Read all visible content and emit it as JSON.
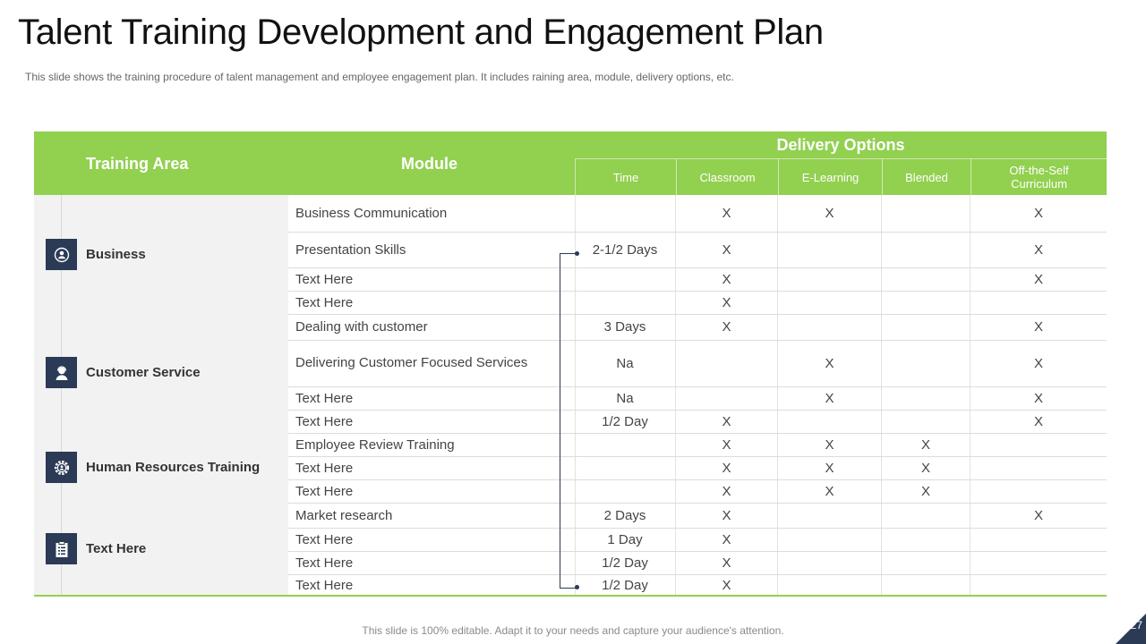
{
  "slide": {
    "title": "Talent Training Development and Engagement Plan",
    "subtitle": "This slide shows the training procedure  of talent management  and  employee  engagement  plan.  It includes raining area,  module,  delivery  options, etc.",
    "footer": "This slide is 100% editable. Adapt it to your needs and capture your audience's attention.",
    "page_number": "27"
  },
  "colors": {
    "accent_green": "#92d050",
    "icon_navy": "#2b3a55"
  },
  "table": {
    "headers": {
      "training_area": "Training Area",
      "module": "Module",
      "delivery_options": "Delivery Options",
      "time": "Time",
      "classroom": "Classroom",
      "elearning": "E-Learning",
      "blended": "Blended",
      "ots": "Off-the-Self Curriculum"
    },
    "areas": [
      {
        "label": "Business",
        "icon": "person-circle-icon"
      },
      {
        "label": "Customer Service",
        "icon": "headset-person-icon"
      },
      {
        "label": "Human Resources Training",
        "icon": "gear-person-icon"
      },
      {
        "label": "Text Here",
        "icon": "clipboard-icon"
      }
    ],
    "rows": [
      {
        "module": "Business Communication",
        "time": "",
        "classroom": "X",
        "elearning": "X",
        "blended": "",
        "ots": "X"
      },
      {
        "module": "Presentation Skills",
        "time": "2-1/2 Days",
        "classroom": "X",
        "elearning": "",
        "blended": "",
        "ots": "X"
      },
      {
        "module": "Text Here",
        "time": "",
        "classroom": "X",
        "elearning": "",
        "blended": "",
        "ots": "X"
      },
      {
        "module": "Text Here",
        "time": "",
        "classroom": "X",
        "elearning": "",
        "blended": "",
        "ots": ""
      },
      {
        "module": "Dealing with customer",
        "time": "3 Days",
        "classroom": "X",
        "elearning": "",
        "blended": "",
        "ots": "X"
      },
      {
        "module": "Delivering Customer Focused Services",
        "time": "Na",
        "classroom": "",
        "elearning": "X",
        "blended": "",
        "ots": "X"
      },
      {
        "module": "Text Here",
        "time": "Na",
        "classroom": "",
        "elearning": "X",
        "blended": "",
        "ots": "X"
      },
      {
        "module": "Text Here",
        "time": "1/2 Day",
        "classroom": "X",
        "elearning": "",
        "blended": "",
        "ots": "X"
      },
      {
        "module": "Employee Review Training",
        "time": "",
        "classroom": "X",
        "elearning": "X",
        "blended": "X",
        "ots": ""
      },
      {
        "module": "Text Here",
        "time": "",
        "classroom": "X",
        "elearning": "X",
        "blended": "X",
        "ots": ""
      },
      {
        "module": "Text Here",
        "time": "",
        "classroom": "X",
        "elearning": "X",
        "blended": "X",
        "ots": ""
      },
      {
        "module": "Market research",
        "time": "2 Days",
        "classroom": "X",
        "elearning": "",
        "blended": "",
        "ots": "X"
      },
      {
        "module": "Text Here",
        "time": "1 Day",
        "classroom": "X",
        "elearning": "",
        "blended": "",
        "ots": ""
      },
      {
        "module": "Text Here",
        "time": "1/2 Day",
        "classroom": "X",
        "elearning": "",
        "blended": "",
        "ots": ""
      },
      {
        "module": "Text Here",
        "time": "1/2 Day",
        "classroom": "X",
        "elearning": "",
        "blended": "",
        "ots": ""
      }
    ]
  }
}
